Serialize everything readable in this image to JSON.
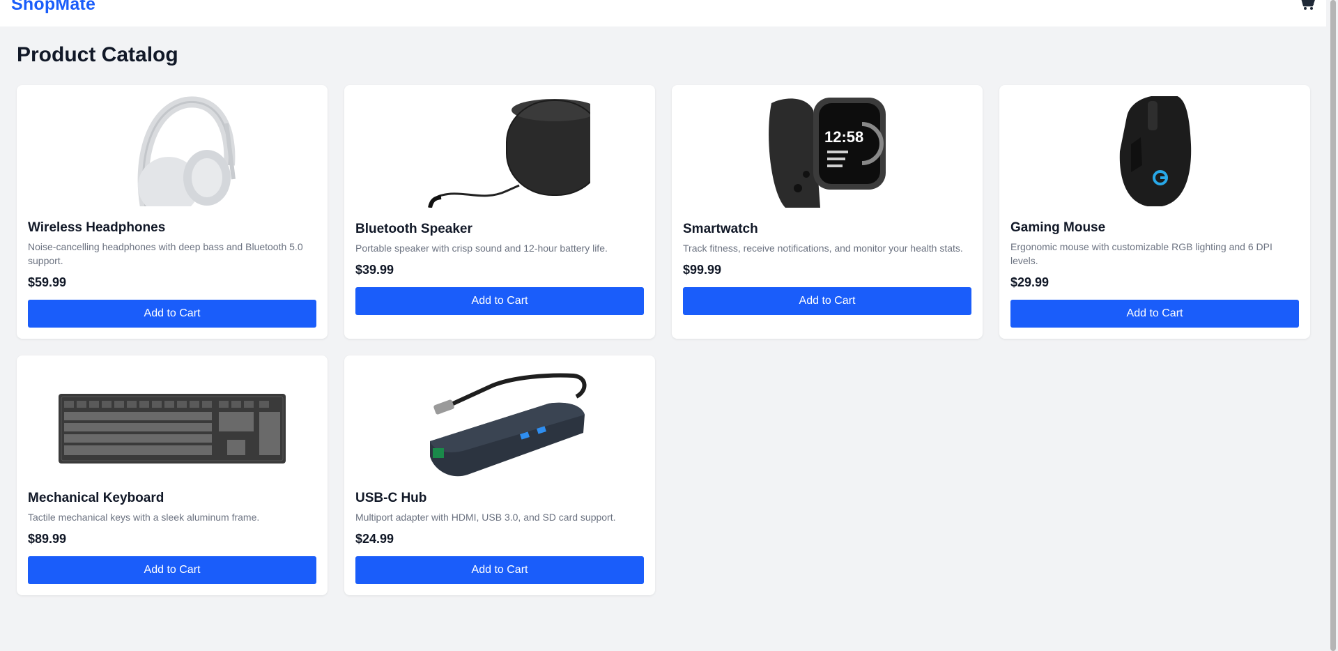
{
  "header": {
    "brand": "ShopMate",
    "cart_icon": "shopping-cart-icon"
  },
  "page_title": "Product Catalog",
  "colors": {
    "accent": "#1a5dfa",
    "background": "#f2f3f5",
    "card": "#ffffff",
    "muted_text": "#6b7280"
  },
  "products": [
    {
      "name": "Wireless Headphones",
      "description": "Noise-cancelling headphones with deep bass and Bluetooth 5.0 support.",
      "price": "$59.99",
      "button": "Add to Cart",
      "image": "headphones-image"
    },
    {
      "name": "Bluetooth Speaker",
      "description": "Portable speaker with crisp sound and 12-hour battery life.",
      "price": "$39.99",
      "button": "Add to Cart",
      "image": "speaker-image"
    },
    {
      "name": "Smartwatch",
      "description": "Track fitness, receive notifications, and monitor your health stats.",
      "price": "$99.99",
      "button": "Add to Cart",
      "image": "smartwatch-image"
    },
    {
      "name": "Gaming Mouse",
      "description": "Ergonomic mouse with customizable RGB lighting and 6 DPI levels.",
      "price": "$29.99",
      "button": "Add to Cart",
      "image": "gaming-mouse-image"
    },
    {
      "name": "Mechanical Keyboard",
      "description": "Tactile mechanical keys with a sleek aluminum frame.",
      "price": "$89.99",
      "button": "Add to Cart",
      "image": "keyboard-image"
    },
    {
      "name": "USB-C Hub",
      "description": "Multiport adapter with HDMI, USB 3.0, and SD card support.",
      "price": "$24.99",
      "button": "Add to Cart",
      "image": "usb-hub-image"
    }
  ]
}
